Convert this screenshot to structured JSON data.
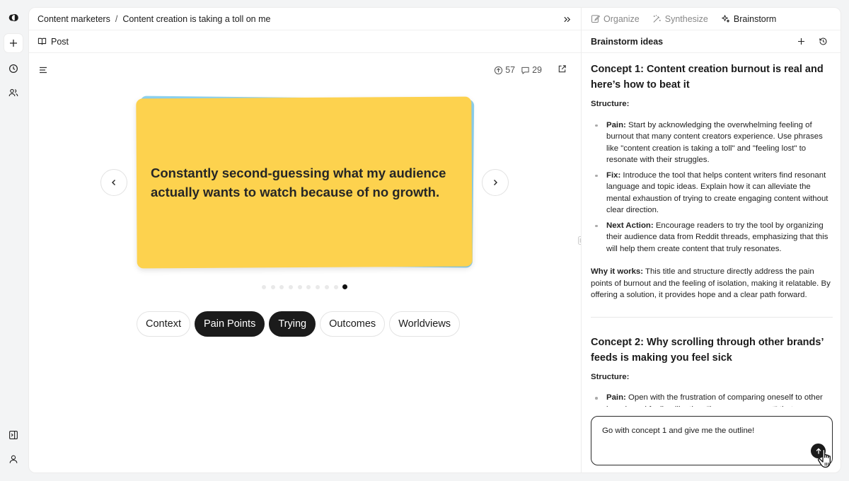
{
  "rail": {
    "icons": [
      "logo-icon",
      "plus-icon",
      "clock-icon",
      "users-icon",
      "sidebar-icon",
      "user-icon"
    ]
  },
  "breadcrumb": {
    "parent": "Content marketers",
    "separator": "/",
    "current": "Content creation is taking a toll on me"
  },
  "subbar": {
    "label": "Post"
  },
  "stats": {
    "upvotes": "57",
    "comments": "29"
  },
  "card": {
    "text": "Constantly second-guessing what my audience actually wants to watch because of no growth.",
    "colors": {
      "front": "#fdd24e",
      "back": "#8fd3f0"
    }
  },
  "carousel": {
    "total_dots": 10,
    "active_index": 9
  },
  "chips": [
    {
      "label": "Context",
      "selected": false
    },
    {
      "label": "Pain Points",
      "selected": true
    },
    {
      "label": "Trying",
      "selected": true
    },
    {
      "label": "Outcomes",
      "selected": false
    },
    {
      "label": "Worldviews",
      "selected": false
    }
  ],
  "side": {
    "tabs": [
      {
        "label": "Organize",
        "icon": "organize-icon",
        "active": false
      },
      {
        "label": "Synthesize",
        "icon": "wand-icon",
        "active": false
      },
      {
        "label": "Brainstorm",
        "icon": "sparkle-icon",
        "active": true
      }
    ],
    "header": "Brainstorm ideas",
    "concepts": [
      {
        "title": "Concept 1: Content creation burnout is real and here’s how to beat it",
        "structure_label": "Structure:",
        "points": [
          {
            "label": "Pain:",
            "text": " Start by acknowledging the overwhelming feeling of burnout that many content creators experience. Use phrases like \"content creation is taking a toll\" and \"feeling lost\" to resonate with their struggles."
          },
          {
            "label": "Fix:",
            "text": " Introduce the tool that helps content writers find resonant language and topic ideas. Explain how it can alleviate the mental exhaustion of trying to create engaging content without clear direction."
          },
          {
            "label": "Next Action:",
            "text": " Encourage readers to try the tool by organizing their audience data from Reddit threads, emphasizing that this will help them create content that truly resonates."
          }
        ],
        "why_label": "Why it works:",
        "why_text": " This title and structure directly address the pain points of burnout and the feeling of isolation, making it relatable. By offering a solution, it provides hope and a clear path forward."
      },
      {
        "title": "Concept 2: Why scrolling through other brands’ feeds is making you feel sick",
        "structure_label": "Structure:",
        "points": [
          {
            "label": "Pain:",
            "text": " Open with the frustration of comparing oneself to other brands and feeling like they \"know some secret\" that you"
          }
        ]
      }
    ],
    "input": {
      "value": "Go with concept 1 and give me the outline!"
    }
  }
}
